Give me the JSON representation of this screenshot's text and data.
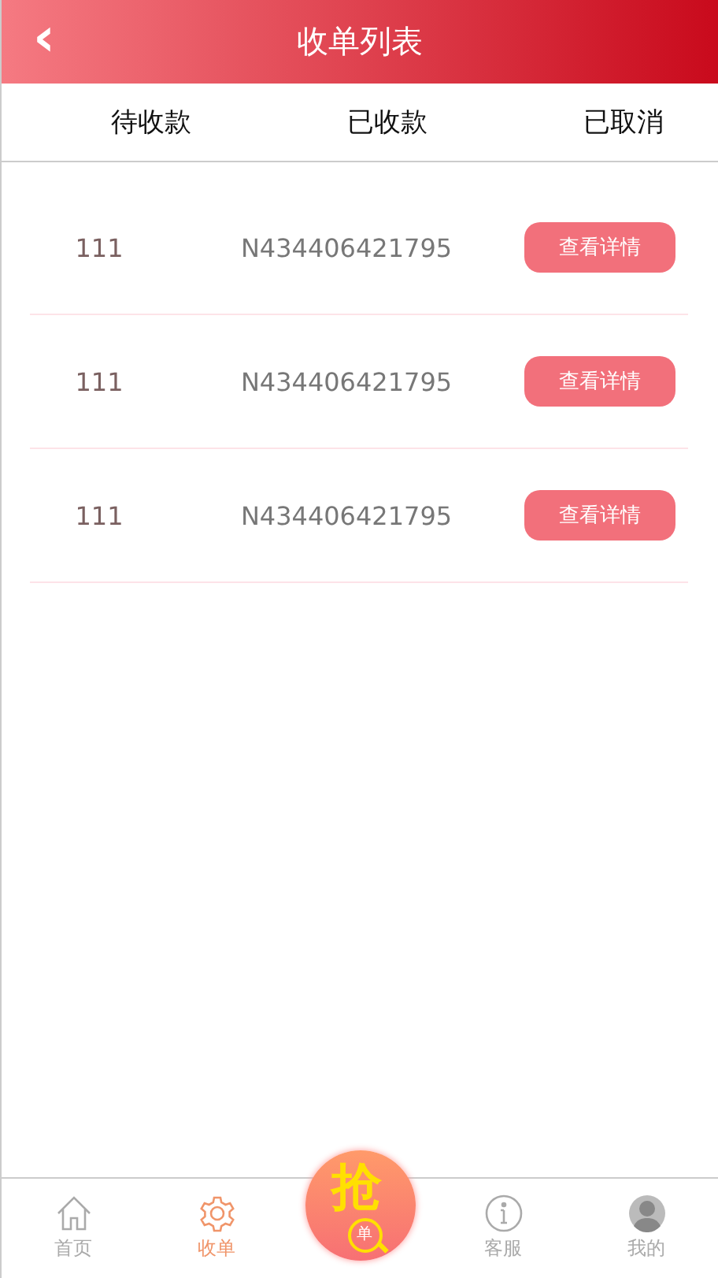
{
  "header": {
    "back_icon": "‹",
    "title": "收单列表"
  },
  "tabs": [
    {
      "label": "待收款"
    },
    {
      "label": "已收款"
    },
    {
      "label": "已取消"
    }
  ],
  "orders": [
    {
      "amount": "111",
      "order_no": "N434406421795",
      "action": "查看详情"
    },
    {
      "amount": "111",
      "order_no": "N434406421795",
      "action": "查看详情"
    },
    {
      "amount": "111",
      "order_no": "N434406421795",
      "action": "查看详情"
    }
  ],
  "bottom_nav": [
    {
      "kind": "home",
      "label": "首页",
      "selected": false
    },
    {
      "kind": "gear",
      "label": "收单",
      "selected": true
    },
    {
      "kind": "grab",
      "label": "抢",
      "badge": "单",
      "selected": false
    },
    {
      "kind": "info",
      "label": "客服",
      "selected": false
    },
    {
      "kind": "user",
      "label": "我的",
      "selected": false
    }
  ]
}
